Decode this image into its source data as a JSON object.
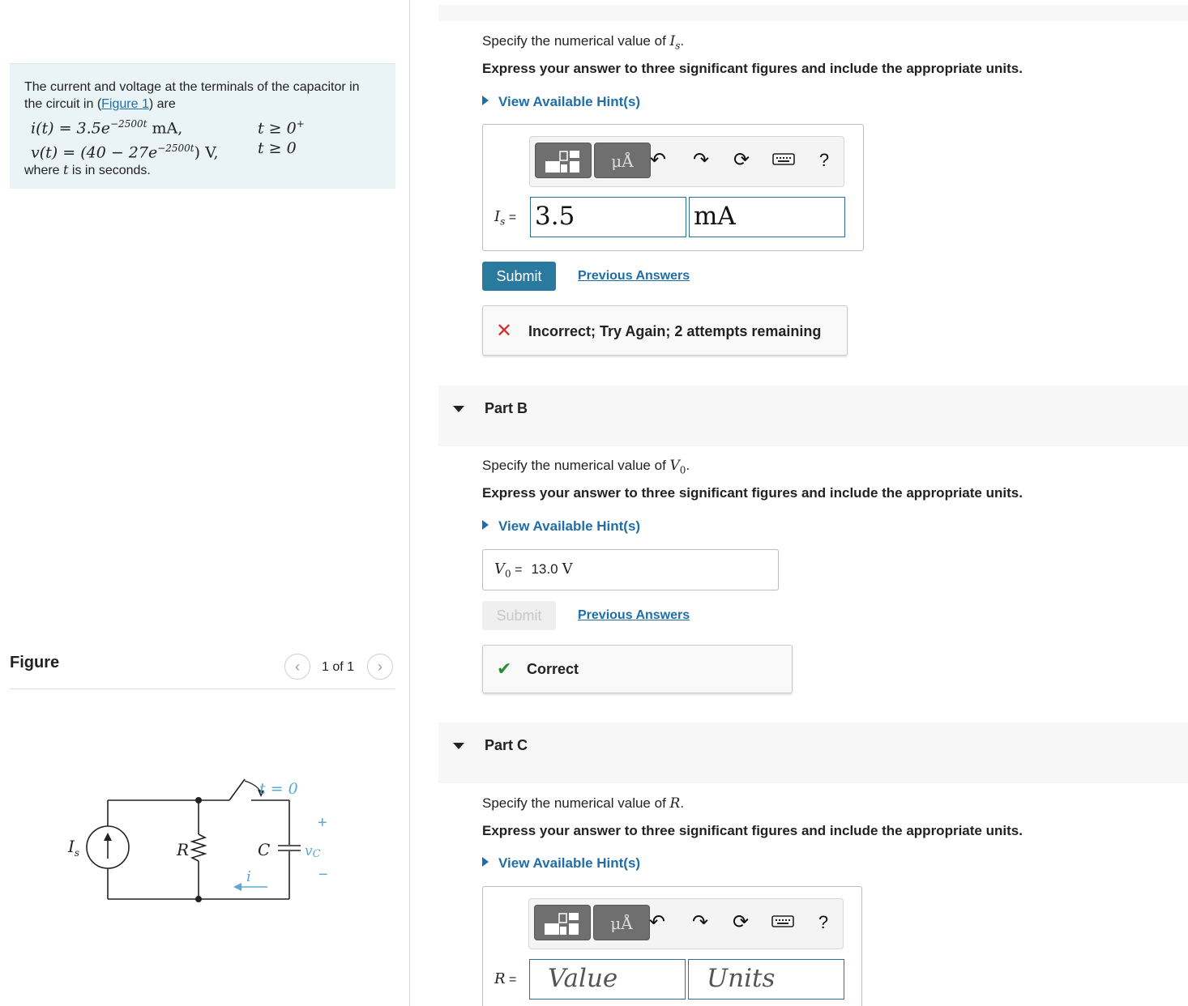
{
  "problem": {
    "intro_before_link": "The current and voltage at the terminals of the capacitor in the circuit in (",
    "figure_link": "Figure 1",
    "intro_after_link": ") are",
    "eq1_lhs": "i(t) = 3.5e",
    "eq1_exp": "−2500t",
    "eq1_unit": " mA,",
    "eq1_cond": "t ≥ 0",
    "eq1_cond_sup": "+",
    "eq2_lhs": "v(t) = (40 − 27e",
    "eq2_exp": "−2500t",
    "eq2_unit": ") V,",
    "eq2_cond": "t ≥ 0",
    "footer_before": "where ",
    "footer_var": "t",
    "footer_after": " is in seconds."
  },
  "figure": {
    "title": "Figure",
    "page_count": "1 of 1",
    "prev_glyph": "‹",
    "next_glyph": "›",
    "labels": {
      "source": "I",
      "source_sub": "s",
      "resistor": "R",
      "capacitor": "C",
      "switch": "t = 0",
      "voltage": "v",
      "voltage_sub": "C",
      "plus": "+",
      "minus": "−",
      "current": "i"
    }
  },
  "partA": {
    "prompt_before": "Specify the numerical value of ",
    "prompt_var": "I",
    "prompt_sub": "s",
    "prompt_after": ".",
    "instruction": "Express your answer to three significant figures and include the appropriate units.",
    "hint": "View Available Hint(s)",
    "var_label": "I",
    "var_sub": "s",
    "equals": " =",
    "value": "3.5",
    "units": "mA",
    "submit": "Submit",
    "previous_answers": "Previous Answers",
    "feedback_icon": "✕",
    "feedback": "Incorrect; Try Again; 2 attempts remaining"
  },
  "partB": {
    "title": "Part B",
    "prompt_before": "Specify the numerical value of ",
    "prompt_var": "V",
    "prompt_sub": "0",
    "prompt_after": ".",
    "instruction": "Express your answer to three significant figures and include the appropriate units.",
    "hint": "View Available Hint(s)",
    "var_label": "V",
    "var_sub": "0",
    "equals": " =",
    "value": "13.0",
    "units": "V",
    "submit": "Submit",
    "previous_answers": "Previous Answers",
    "feedback_icon": "✔",
    "feedback": "Correct"
  },
  "partC": {
    "title": "Part C",
    "prompt_before": "Specify the numerical value of ",
    "prompt_var": "R",
    "prompt_after": ".",
    "instruction": "Express your answer to three significant figures and include the appropriate units.",
    "hint": "View Available Hint(s)",
    "var_label": "R",
    "equals": " =",
    "value_placeholder": "Value",
    "units_placeholder": "Units"
  },
  "toolbar": {
    "units_glyph": "μÅ",
    "help_glyph": "?"
  },
  "colors": {
    "accent": "#2a7aa0",
    "link": "#1f6ea8",
    "incorrect": "#d32f2f",
    "correct": "#2e8b3a",
    "problem_bg": "#eaf4f7",
    "circuit_annotation": "#5ba8d6"
  }
}
